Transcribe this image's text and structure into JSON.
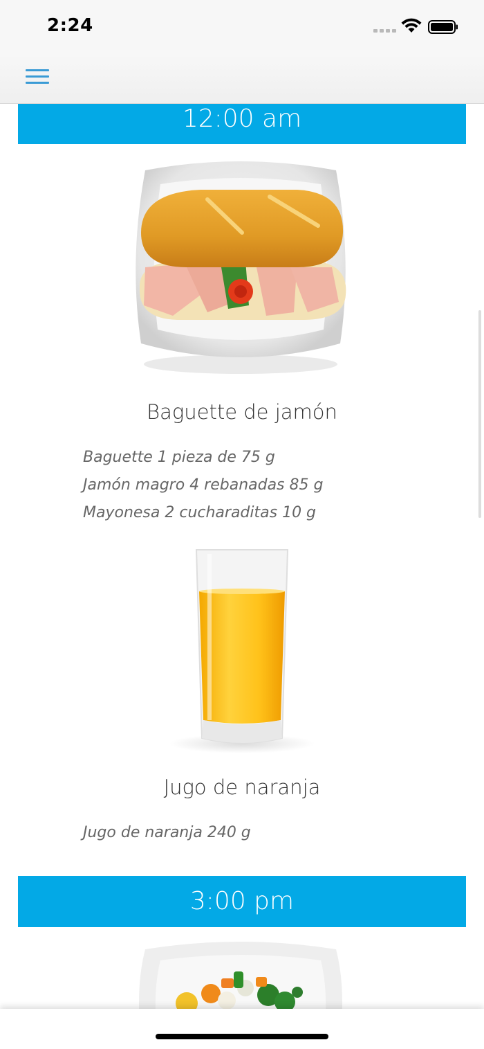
{
  "status_bar": {
    "time": "2:24"
  },
  "nav": {
    "menu_icon": "hamburger-menu-icon"
  },
  "colors": {
    "accent": "#03a9e6",
    "menu": "#3a9bd5"
  },
  "meals": [
    {
      "time": "12:00 am",
      "items": [
        {
          "name": "Baguette de jamón",
          "image": "ham-baguette-plate-image",
          "ingredients": [
            "Baguette 1 pieza de 75 g",
            "Jamón magro 4 rebanadas 85 g",
            "Mayonesa 2 cucharaditas 10 g"
          ]
        },
        {
          "name": "Jugo de naranja",
          "image": "orange-juice-glass-image",
          "ingredients": [
            "Jugo de naranja 240 g"
          ]
        }
      ]
    },
    {
      "time": "3:00 pm",
      "items": [
        {
          "image": "vegetable-plate-image"
        }
      ]
    }
  ]
}
